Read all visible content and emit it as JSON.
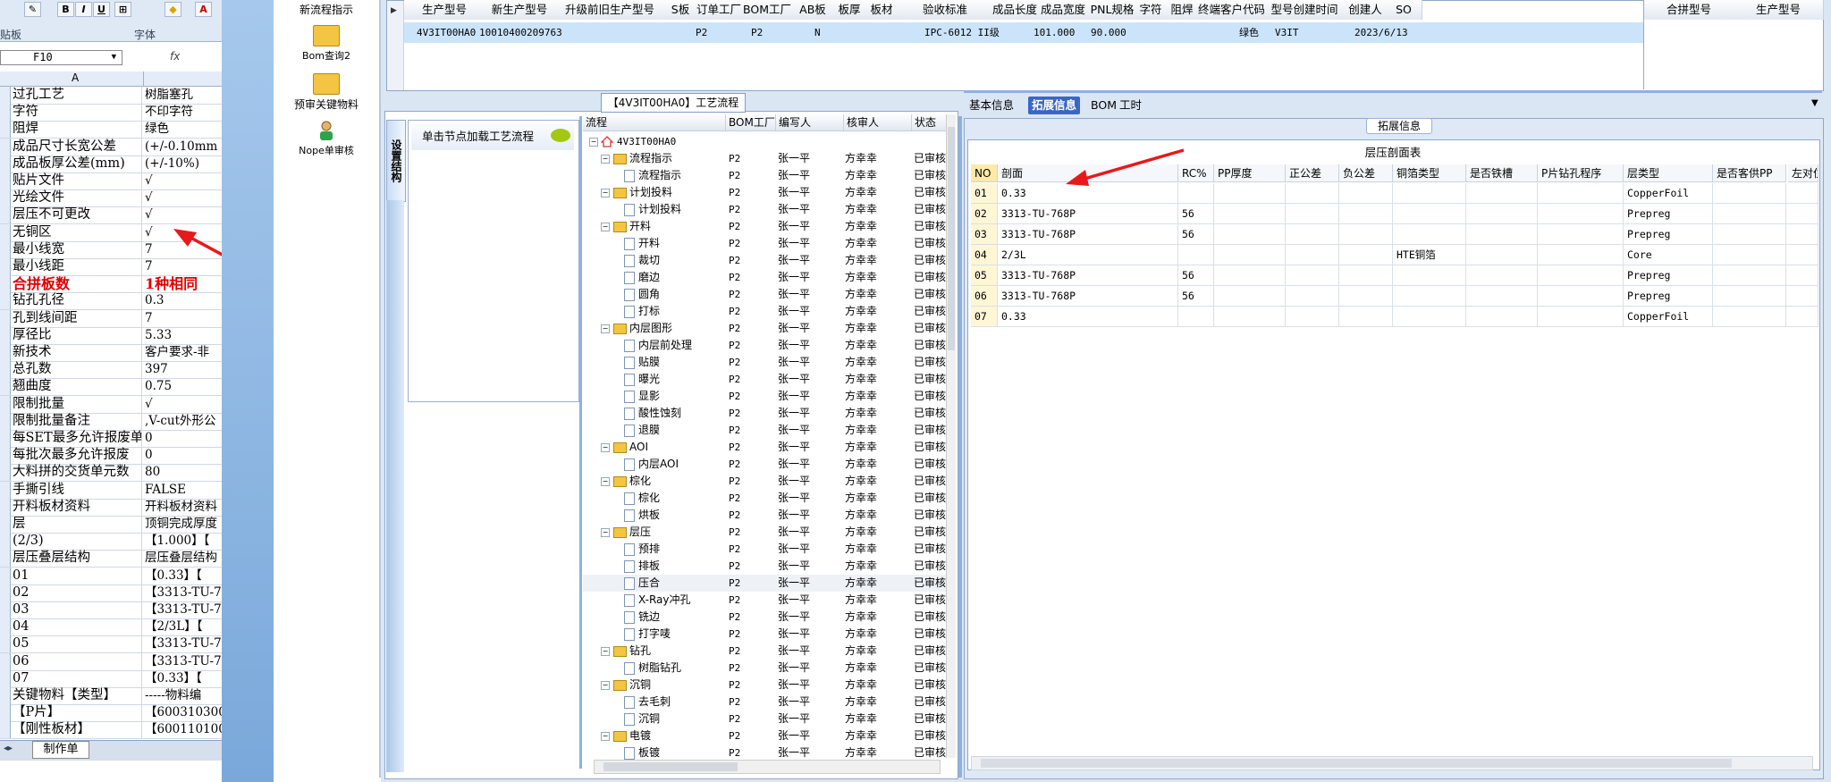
{
  "excel": {
    "font_group_label": "字体",
    "left_group_label": "贴板",
    "namebox": "F10",
    "fx": "fx",
    "col_header": "A",
    "rows": [
      {
        "a": "过孔工艺",
        "b": "树脂塞孔"
      },
      {
        "a": "字符",
        "b": "不印字符"
      },
      {
        "a": "阻焊",
        "b": "绿色"
      },
      {
        "a": "成品尺寸长宽公差",
        "b": "(+/-0.10mm"
      },
      {
        "a": "成品板厚公差(mm)",
        "b": "(+/-10%)"
      },
      {
        "a": "贴片文件",
        "b": "√"
      },
      {
        "a": "光绘文件",
        "b": "√"
      },
      {
        "a": "层压不可更改",
        "b": "√"
      },
      {
        "a": "无铜区",
        "b": "√"
      },
      {
        "a": "最小线宽",
        "b": "7"
      },
      {
        "a": "最小线距",
        "b": "7"
      },
      {
        "a": "合拼板数",
        "b": "1种相同",
        "red": true
      },
      {
        "a": "钻孔孔径",
        "b": "0.3"
      },
      {
        "a": "孔到线间距",
        "b": "7"
      },
      {
        "a": "厚径比",
        "b": "5.33"
      },
      {
        "a": "新技术",
        "b": "客户要求-非"
      },
      {
        "a": "总孔数",
        "b": "397"
      },
      {
        "a": "翘曲度",
        "b": "0.75"
      },
      {
        "a": "限制批量",
        "b": "√"
      },
      {
        "a": "限制批量备注",
        "b": ",V-cut外形公"
      },
      {
        "a": "每SET最多允许报废单",
        "b": "0"
      },
      {
        "a": "每批次最多允许报废",
        "b": "0"
      },
      {
        "a": "大料拼的交货单元数",
        "b": "80"
      },
      {
        "a": "手撕引线",
        "b": "FALSE"
      },
      {
        "a": "开料板材资料",
        "b": "开料板材资料"
      },
      {
        "a": "层",
        "b": "顶铜完成厚度"
      },
      {
        "a": "(2/3)",
        "b": "【1.000】【"
      },
      {
        "a": "层压叠层结构",
        "b": "层压叠层结构"
      },
      {
        "a": "01",
        "b": "【0.33】【"
      },
      {
        "a": "02",
        "b": "【3313-TU-7"
      },
      {
        "a": "03",
        "b": "【3313-TU-7"
      },
      {
        "a": "04",
        "b": "【2/3L】【"
      },
      {
        "a": "05",
        "b": "【3313-TU-7"
      },
      {
        "a": "06",
        "b": "【3313-TU-7"
      },
      {
        "a": "07",
        "b": "【0.33】【"
      },
      {
        "a": "关键物料【类型】",
        "b": "-----物料编"
      },
      {
        "a": "【P片】",
        "b": "【6003103000"
      },
      {
        "a": "【刚性板材】",
        "b": "【6001101000"
      }
    ],
    "sheet_tab": "制作单"
  },
  "toolbar": {
    "items": [
      {
        "label": "新流程指示"
      },
      {
        "label": "Bom查询2"
      },
      {
        "label": "预审关键物料"
      },
      {
        "label": "Nope单审核"
      }
    ]
  },
  "top_grid": {
    "headers": [
      "生产型号",
      "新生产型号",
      "升级前旧生产型号",
      "S板",
      "订单工厂",
      "BOM工厂",
      "AB板",
      "板厚",
      "板材",
      "验收标准",
      "成品长度",
      "成品宽度",
      "PNL规格",
      "字符",
      "阻焊",
      "终端客户代码",
      "型号创建时间",
      "创建人",
      "SO"
    ],
    "row": {
      "model": "4V3IT00HA0",
      "new_model": "10010400209763",
      "order_factory": "P2",
      "bom_factory": "P2",
      "ab": "N",
      "acceptance": "IPC-6012 II级",
      "length": "101.000",
      "width": "90.000",
      "mask": "绿色",
      "customer": "V3IT",
      "created": "2023/6/13"
    },
    "right_headers": [
      "合拼型号",
      "生产型号"
    ]
  },
  "process": {
    "title": "【4V3IT00HA0】工艺流程",
    "vtab": "设置结构",
    "hint": "单击节点加载工艺流程",
    "headers": [
      "流程",
      "BOM工厂",
      "编写人",
      "核审人",
      "状态"
    ],
    "root": "4V3IT00HA0",
    "rows": [
      {
        "name": "流程指示",
        "level": 1,
        "folder": true
      },
      {
        "name": "流程指示",
        "level": 2
      },
      {
        "name": "计划投料",
        "level": 1,
        "folder": true
      },
      {
        "name": "计划投料",
        "level": 2
      },
      {
        "name": "开料",
        "level": 1,
        "folder": true
      },
      {
        "name": "开料",
        "level": 2
      },
      {
        "name": "裁切",
        "level": 2
      },
      {
        "name": "磨边",
        "level": 2
      },
      {
        "name": "圆角",
        "level": 2
      },
      {
        "name": "打标",
        "level": 2
      },
      {
        "name": "内层图形",
        "level": 1,
        "folder": true
      },
      {
        "name": "内层前处理",
        "level": 2
      },
      {
        "name": "贴膜",
        "level": 2
      },
      {
        "name": "曝光",
        "level": 2
      },
      {
        "name": "显影",
        "level": 2
      },
      {
        "name": "酸性蚀刻",
        "level": 2
      },
      {
        "name": "退膜",
        "level": 2
      },
      {
        "name": "AOI",
        "level": 1,
        "folder": true
      },
      {
        "name": "内层AOI",
        "level": 2
      },
      {
        "name": "棕化",
        "level": 1,
        "folder": true
      },
      {
        "name": "棕化",
        "level": 2
      },
      {
        "name": "烘板",
        "level": 2
      },
      {
        "name": "层压",
        "level": 1,
        "folder": true
      },
      {
        "name": "预排",
        "level": 2
      },
      {
        "name": "排板",
        "level": 2
      },
      {
        "name": "压合",
        "level": 2,
        "selected": true
      },
      {
        "name": "X-Ray冲孔",
        "level": 2
      },
      {
        "name": "铣边",
        "level": 2
      },
      {
        "name": "打字唛",
        "level": 2
      },
      {
        "name": "钻孔",
        "level": 1,
        "folder": true
      },
      {
        "name": "树脂钻孔",
        "level": 2
      },
      {
        "name": "沉铜",
        "level": 1,
        "folder": true
      },
      {
        "name": "去毛刺",
        "level": 2
      },
      {
        "name": "沉铜",
        "level": 2
      },
      {
        "name": "电镀",
        "level": 1,
        "folder": true
      },
      {
        "name": "板镀",
        "level": 2
      }
    ],
    "bom": "P2",
    "writer": "张一平",
    "reviewer": "方幸幸",
    "status": "已审核"
  },
  "detail": {
    "tabs": [
      "基本信息",
      "拓展信息",
      "BOM",
      "工时"
    ],
    "active_tab": 1,
    "group_title": "拓展信息",
    "table_title": "层压剖面表",
    "headers": [
      "NO",
      "剖面",
      "RC%",
      "PP厚度",
      "正公差",
      "负公差",
      "铜箔类型",
      "是否铁槽",
      "P片钻孔程序",
      "层类型",
      "是否客供PP",
      "左对位"
    ],
    "rows": [
      {
        "no": "01",
        "profile": "0.33",
        "rc": "",
        "foil": "",
        "type": "CopperFoil"
      },
      {
        "no": "02",
        "profile": "3313-TU-768P",
        "rc": "56",
        "foil": "",
        "type": "Prepreg"
      },
      {
        "no": "03",
        "profile": "3313-TU-768P",
        "rc": "56",
        "foil": "",
        "type": "Prepreg"
      },
      {
        "no": "04",
        "profile": "2/3L",
        "rc": "",
        "foil": "HTE铜箔",
        "type": "Core"
      },
      {
        "no": "05",
        "profile": "3313-TU-768P",
        "rc": "56",
        "foil": "",
        "type": "Prepreg"
      },
      {
        "no": "06",
        "profile": "3313-TU-768P",
        "rc": "56",
        "foil": "",
        "type": "Prepreg"
      },
      {
        "no": "07",
        "profile": "0.33",
        "rc": "",
        "foil": "",
        "type": "CopperFoil"
      }
    ]
  },
  "colors": {
    "arrow": "#e8191b",
    "selected_row": "#cbe4fa",
    "active_tab": "#3a67c4"
  }
}
